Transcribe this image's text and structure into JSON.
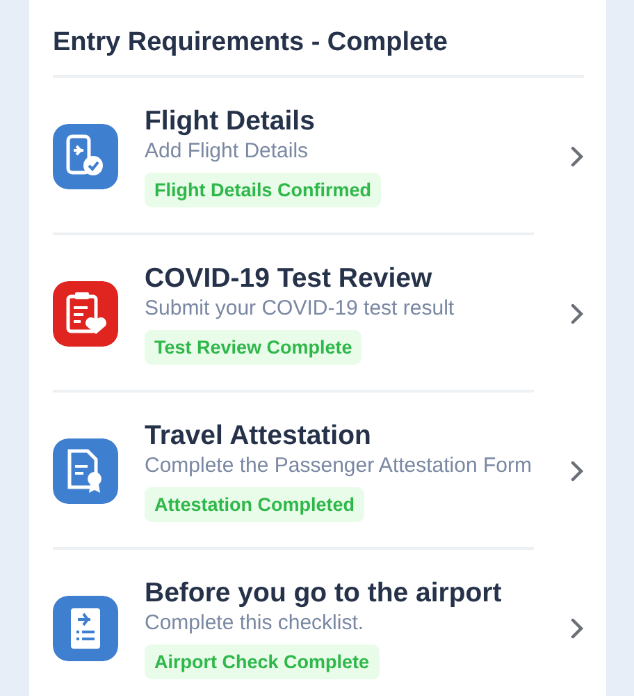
{
  "section": {
    "title": "Entry Requirements - Complete"
  },
  "items": [
    {
      "kind": "flight",
      "color": "#3f7fcf",
      "title": "Flight Details",
      "subtitle": "Add Flight Details",
      "status": "Flight Details Confirmed"
    },
    {
      "kind": "health",
      "color": "#e0241f",
      "title": "COVID-19 Test Review",
      "subtitle": "Submit your COVID-19 test result",
      "status": "Test Review Complete"
    },
    {
      "kind": "certificate",
      "color": "#3f7fcf",
      "title": "Travel Attestation",
      "subtitle": "Complete the Passenger Attestation Form",
      "status": "Attestation Completed"
    },
    {
      "kind": "checklist",
      "color": "#3f7fcf",
      "title": "Before you go to the airport",
      "subtitle": "Complete this checklist.",
      "status": "Airport Check Complete"
    }
  ]
}
